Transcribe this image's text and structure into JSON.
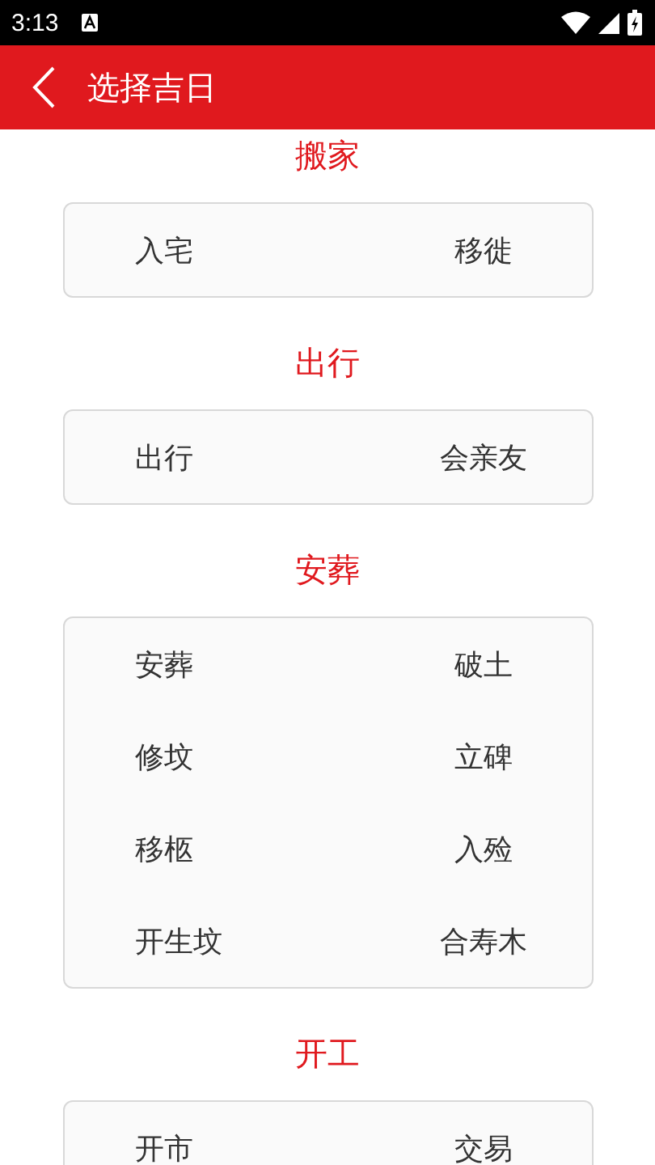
{
  "status_bar": {
    "time": "3:13"
  },
  "header": {
    "title": "选择吉日"
  },
  "sections": [
    {
      "title": "搬家",
      "items": [
        "入宅",
        "移徙"
      ]
    },
    {
      "title": "出行",
      "items": [
        "出行",
        "会亲友"
      ]
    },
    {
      "title": "安葬",
      "items": [
        "安葬",
        "破土",
        "修坟",
        "立碑",
        "移柩",
        "入殓",
        "开生坟",
        "合寿木"
      ]
    },
    {
      "title": "开工",
      "items": [
        "开市",
        "交易"
      ]
    }
  ]
}
